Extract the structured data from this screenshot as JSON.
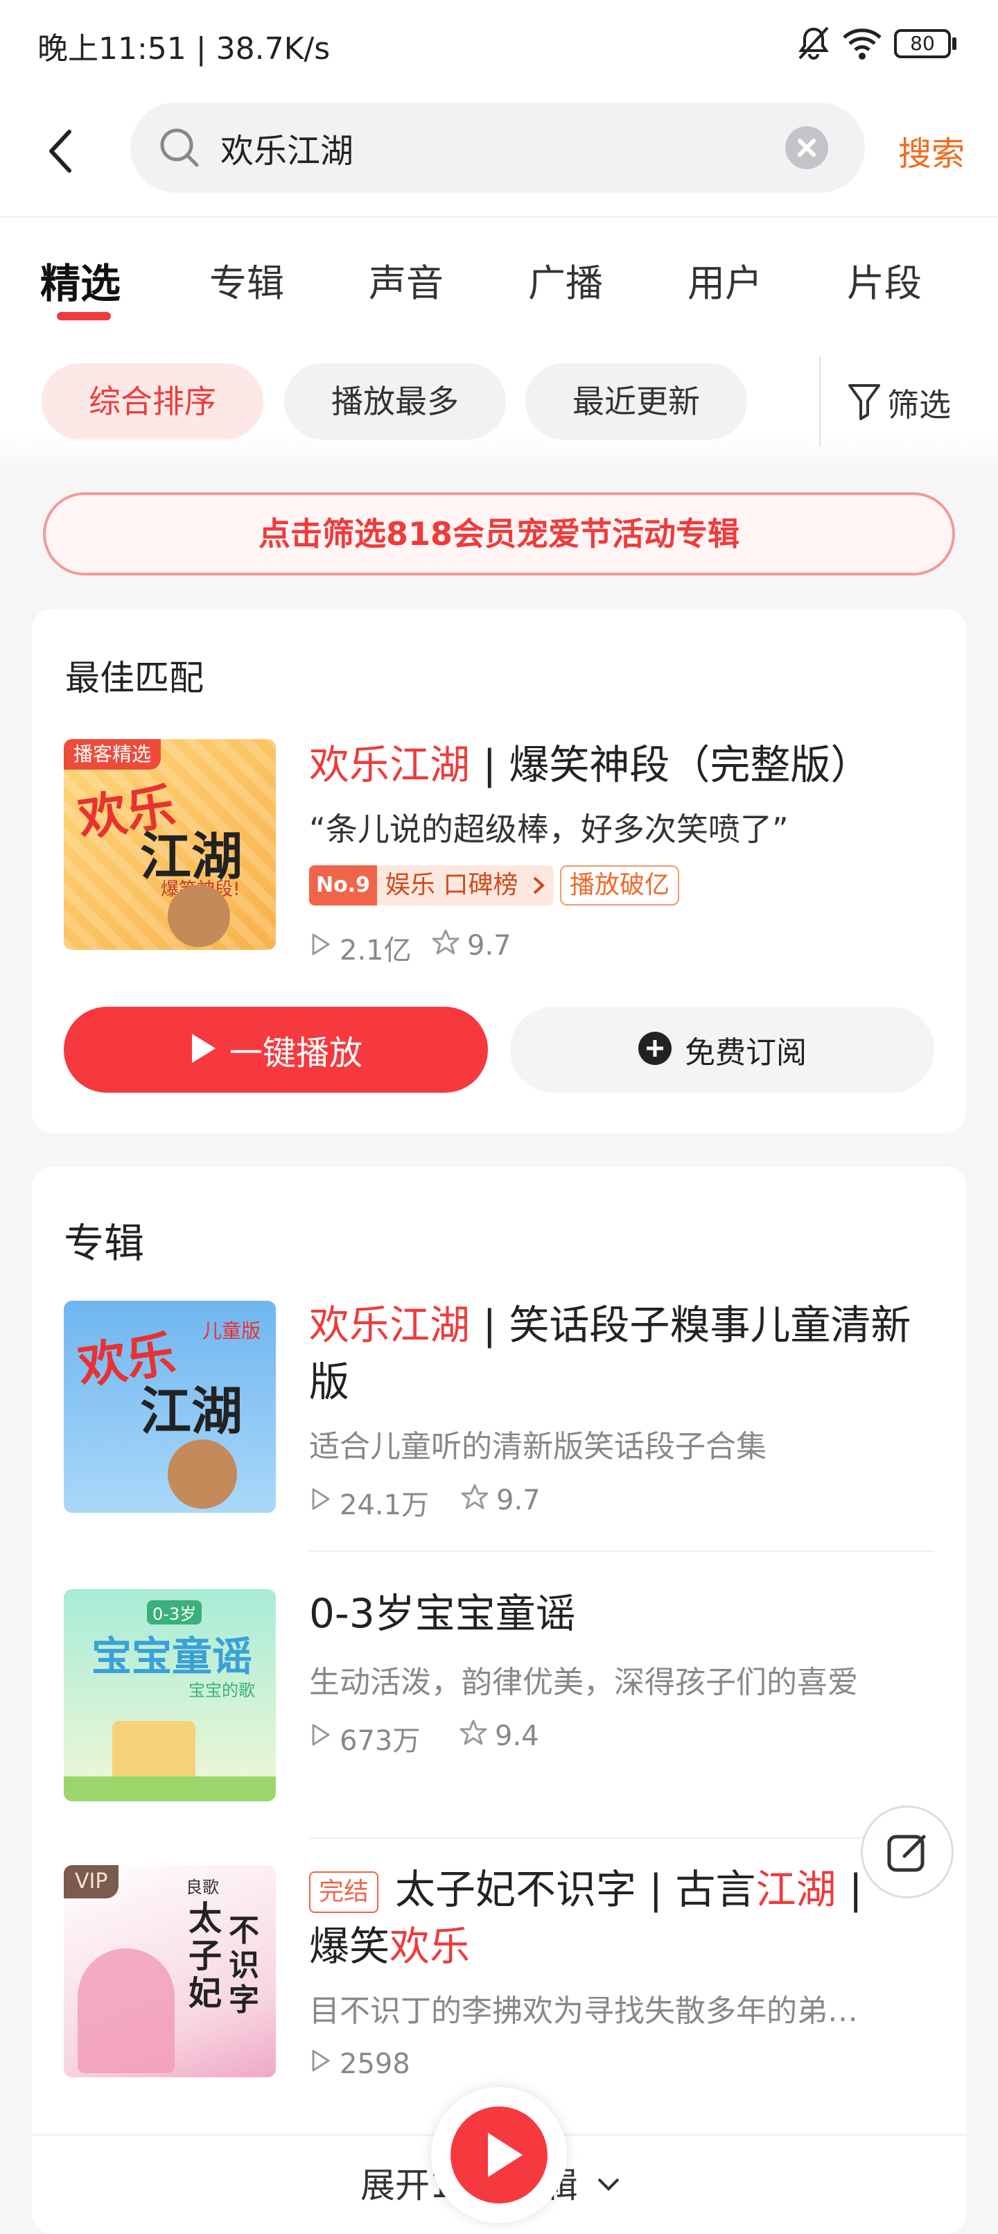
{
  "status": {
    "time": "晚上11:51 | 38.7K/s",
    "battery": "80"
  },
  "search": {
    "query": "欢乐江湖",
    "submit": "搜索"
  },
  "tabs": [
    "精选",
    "专辑",
    "声音",
    "广播",
    "用户",
    "片段"
  ],
  "sort": {
    "comprehensive": "综合排序",
    "most_played": "播放最多",
    "recent": "最近更新",
    "filter": "筛选"
  },
  "banner": "点击筛选818会员宠爱节活动专辑",
  "best": {
    "section": "最佳匹配",
    "badge": "播客精选",
    "title_hl": "欢乐江湖",
    "title_rest": " | 爆笑神段（完整版）",
    "quote": "“条儿说的超级棒，好多次笑喷了”",
    "rank_no": "No.9",
    "rank_text": "娱乐 口碑榜",
    "tag": "播放破亿",
    "plays": "2.1亿",
    "rating": "9.7",
    "play_btn": "一键播放",
    "subscribe_btn": "免费订阅",
    "cover_text1": "欢乐",
    "cover_text2": "江湖",
    "cover_sub": "爆笑神段!"
  },
  "albums": {
    "section": "专辑",
    "items": [
      {
        "title_hl": "欢乐江湖",
        "title_rest": " | 笑话段子糗事儿童清新版",
        "desc": "适合儿童听的清新版笑话段子合集",
        "plays": "24.1万",
        "rating": "9.7",
        "cover_a": "欢乐",
        "cover_b": "江湖",
        "cover_c": "儿童版"
      },
      {
        "title": "0-3岁宝宝童谣",
        "desc": "生动活泼，韵律优美，深得孩子们的喜爱",
        "plays": "673万",
        "rating": "9.4",
        "cover_a": "宝宝童谣",
        "cover_b": "0-3岁",
        "cover_c": "宝宝的歌"
      },
      {
        "tag": "完结",
        "t1": "太子妃不识字 | 古言",
        "t2": "江湖",
        "t3": " |",
        "t4": "爆笑",
        "t5": "欢乐",
        "desc": "目不识丁的李拂欢为寻找失散多年的弟…",
        "plays": "2598",
        "vip": "VIP",
        "cover_a": "太子妃",
        "cover_b": "不识字",
        "cover_c": "良歌"
      }
    ],
    "expand": "展开10个专辑"
  },
  "colors": {
    "accent": "#ef3b3b",
    "orange": "#f26b1d"
  }
}
